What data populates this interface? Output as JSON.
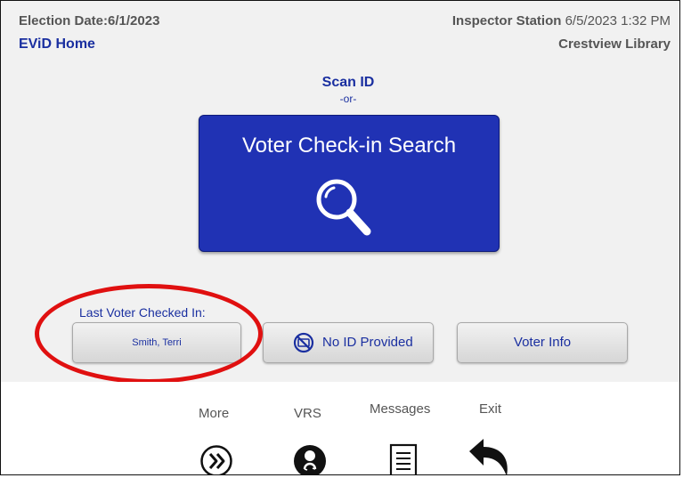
{
  "header": {
    "election_date": "Election Date:6/1/2023",
    "home_link": "EViD Home",
    "station_label": "Inspector Station",
    "station_time": "6/5/2023 1:32 PM",
    "location": "Crestview Library"
  },
  "scan": {
    "title": "Scan ID",
    "or": "-or-",
    "search_button": "Voter Check-in Search"
  },
  "last_voter": {
    "label": "Last Voter Checked In:",
    "name": "Smith, Terri"
  },
  "buttons": {
    "no_id": "No ID Provided",
    "voter_info": "Voter Info"
  },
  "nav": {
    "more": "More",
    "vrs": "VRS",
    "messages": "Messages",
    "exit": "Exit"
  },
  "colors": {
    "accent_blue": "#1a2fa0",
    "search_button_bg": "#2032b4",
    "highlight_red": "#e01010",
    "panel_bg": "#f1f1f1"
  },
  "icons": {
    "search": "magnifier-icon",
    "no_id": "no-id-card-icon",
    "more": "double-chevron-right-icon",
    "vrs": "user-sync-icon",
    "messages": "document-lines-icon",
    "exit": "curved-back-arrow-icon"
  }
}
